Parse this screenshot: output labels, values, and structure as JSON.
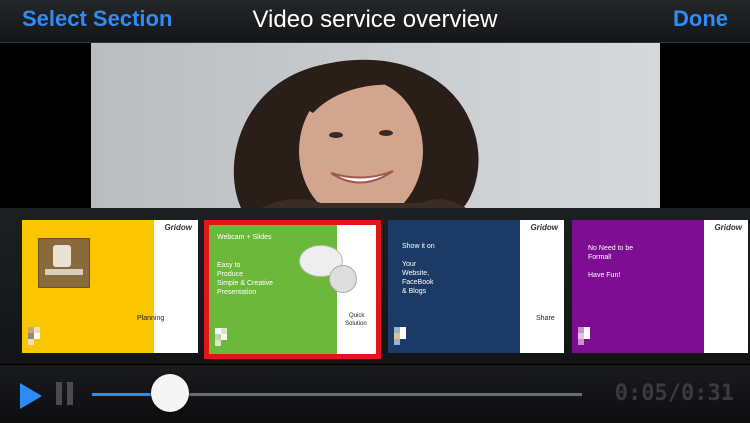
{
  "header": {
    "left_button": "Select Section",
    "title": "Video service overview",
    "right_button": "Done"
  },
  "thumbnails": [
    {
      "logo": "Gridow",
      "caption": "Planning",
      "color": "#fbc500",
      "selected": false
    },
    {
      "logo": "Gridow",
      "heading": "Webcam + Slides",
      "lines": [
        "Easy to",
        "Produce",
        "Simple & Creative",
        "Presentation"
      ],
      "caption_lines": [
        "Quick",
        "Solution"
      ],
      "color": "#6cb83a",
      "selected": true
    },
    {
      "logo": "Gridow",
      "heading": "Show it on",
      "lines": [
        "Your",
        "Website,",
        "FaceBook",
        "& Blogs"
      ],
      "caption": "Share",
      "color": "#1c3a66",
      "selected": false
    },
    {
      "logo": "Gridow",
      "lines": [
        "No Need to be",
        "Formal!",
        "",
        "Have Fun!"
      ],
      "color": "#7d0e93",
      "selected": false
    }
  ],
  "player": {
    "current_time": "0:05",
    "total_time": "0:31",
    "time_display": "0:05/0:31",
    "progress_fraction": 0.16,
    "accent_color": "#2f8cf6"
  },
  "icons": {
    "play": "play-icon",
    "pause": "pause-icon"
  }
}
